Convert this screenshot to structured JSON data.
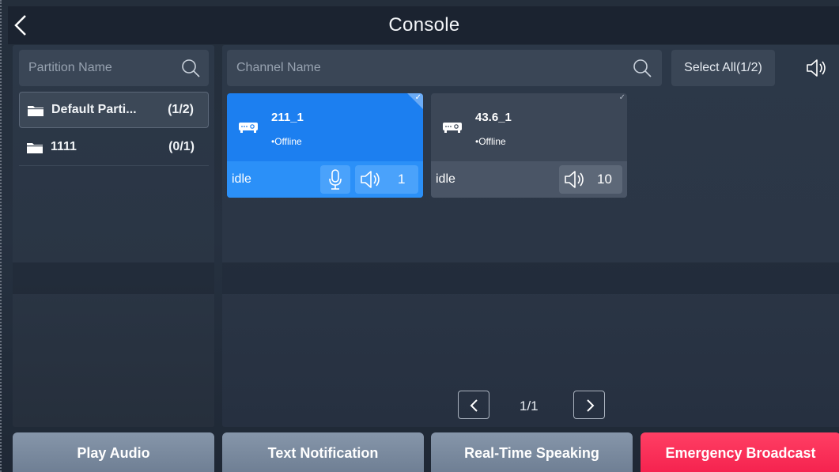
{
  "header": {
    "title": "Console",
    "back_icon": "chevron-left-icon"
  },
  "partition_panel": {
    "search_placeholder": "Partition Name",
    "items": [
      {
        "name": "Default Parti...",
        "count": "(1/2)",
        "active": true
      },
      {
        "name": "1111",
        "count": "(0/1)",
        "active": false
      }
    ]
  },
  "channel_panel": {
    "search_placeholder": "Channel Name",
    "select_all_label": "Select All(1/2)",
    "channels": [
      {
        "name": "211_1",
        "status": "•Offline",
        "state": "idle",
        "volume": "1",
        "selected": true,
        "has_mic": true
      },
      {
        "name": "43.6_1",
        "status": "•Offline",
        "state": "idle",
        "volume": "10",
        "selected": false,
        "has_mic": false
      }
    ],
    "pagination": {
      "text": "1/1"
    }
  },
  "actions": {
    "play_audio": "Play Audio",
    "text_notification": "Text Notification",
    "real_time_speaking": "Real-Time Speaking",
    "emergency_broadcast": "Emergency Broadcast"
  },
  "colors": {
    "selected_card": "#1c7ff0",
    "emergency": "#f5234f",
    "action_gray": "#7a8a9e"
  }
}
